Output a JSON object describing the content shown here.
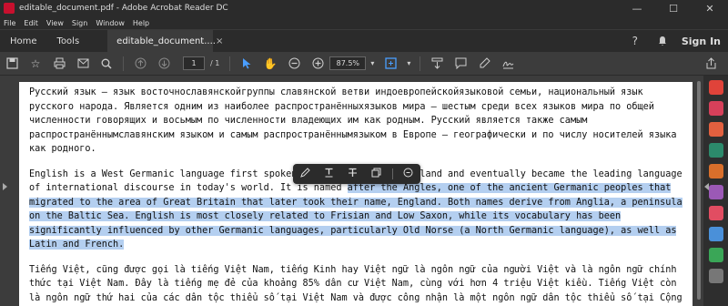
{
  "window": {
    "title": "editable_document.pdf - Adobe Acrobat Reader DC",
    "minimize": "—",
    "maximize": "☐",
    "close": "✕"
  },
  "menu": [
    "File",
    "Edit",
    "View",
    "Sign",
    "Window",
    "Help"
  ],
  "tabs": {
    "home": "Home",
    "tools": "Tools",
    "document": "editable_document....",
    "close": "×",
    "sign_in": "Sign In"
  },
  "toolbar": {
    "page_current": "1",
    "page_total": "/ 1",
    "zoom": "87.5%"
  },
  "document": {
    "p1": "Русский язык — язык восточнославянскойгруппы славянской ветви индоевропейскойязыковой семьи, национальный язык русского народа. Является одним из наиболее распространённыхязыков мира — шестым среди всех языков мира по общей численности говорящих и восьмым по численности владеющих им как родным. Русский является также самым распространённымславянским языком и самым распространённымязыком в Европе — географически и по числу носителей языка как родного.",
    "p2_before": "English is a West Germanic language first spoken in early medieval England and eventually became the leading language of international discourse in today's world. It is named ",
    "p2_selected": "after the Angles, one of the ancient Germanic peoples that migrated to the area of Great Britain that later took their name, England. Both names derive from Anglia, a peninsula on the Baltic Sea. English is most closely related to Frisian and Low Saxon, while its vocabulary has been significantly influenced by other Germanic languages, particularly Old Norse (a North Germanic language), as well as Latin and French.",
    "p3": "Tiếng Việt, cũng được gọi là tiếng Việt Nam, tiếng Kinh hay Việt ngữ là ngôn ngữ của người Việt và là ngôn ngữ chính thức tại Việt Nam. Đây là tiếng mẹ đẻ của khoảng 85% dân cư Việt Nam, cùng với hơn 4 triệu Việt kiều. Tiếng Việt còn là ngôn ngữ thứ hai của các dân tộc thiểu số tại Việt Nam và được công nhận là một ngôn ngữ dân tộc thiểu số tại Cộng hòa Séc."
  },
  "colors": {
    "selection": "#b4cff0",
    "accent": "#4a9eff"
  }
}
